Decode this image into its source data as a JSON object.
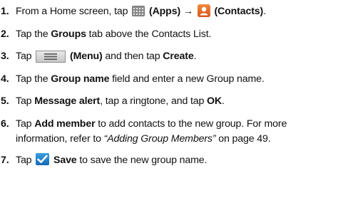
{
  "steps": [
    {
      "num": "1.",
      "t1": "From a Home screen, tap ",
      "apps": "(Apps)",
      "arrow": " → ",
      "contacts": "(Contacts)",
      "end": "."
    },
    {
      "num": "2.",
      "t1": "Tap the ",
      "groups": "Groups",
      "t2": " tab above the Contacts List."
    },
    {
      "num": "3.",
      "t1": "Tap ",
      "menu": "(Menu)",
      "t2": " and then tap ",
      "create": "Create",
      "end": "."
    },
    {
      "num": "4.",
      "t1": "Tap the ",
      "field": "Group name",
      "t2": " field and enter a new Group name."
    },
    {
      "num": "5.",
      "t1": "Tap ",
      "alert": "Message alert",
      "t2": ", tap a ringtone, and tap ",
      "ok": "OK",
      "end": "."
    },
    {
      "num": "6.",
      "t1": "Tap ",
      "add": "Add member",
      "t2": " to add contacts to the new group. For more information, refer to ",
      "ref": "“Adding Group Members”",
      "t3": " on page 49."
    },
    {
      "num": "7.",
      "t1": "Tap ",
      "save": "Save",
      "t2": " to save the new group name."
    }
  ],
  "icons": {
    "apps": "apps-icon",
    "contacts": "contacts-icon",
    "menu": "menu-icon",
    "save": "check-icon"
  },
  "colors": {
    "contacts_icon": "#e0672a",
    "save_icon": "#1f7fcf"
  }
}
